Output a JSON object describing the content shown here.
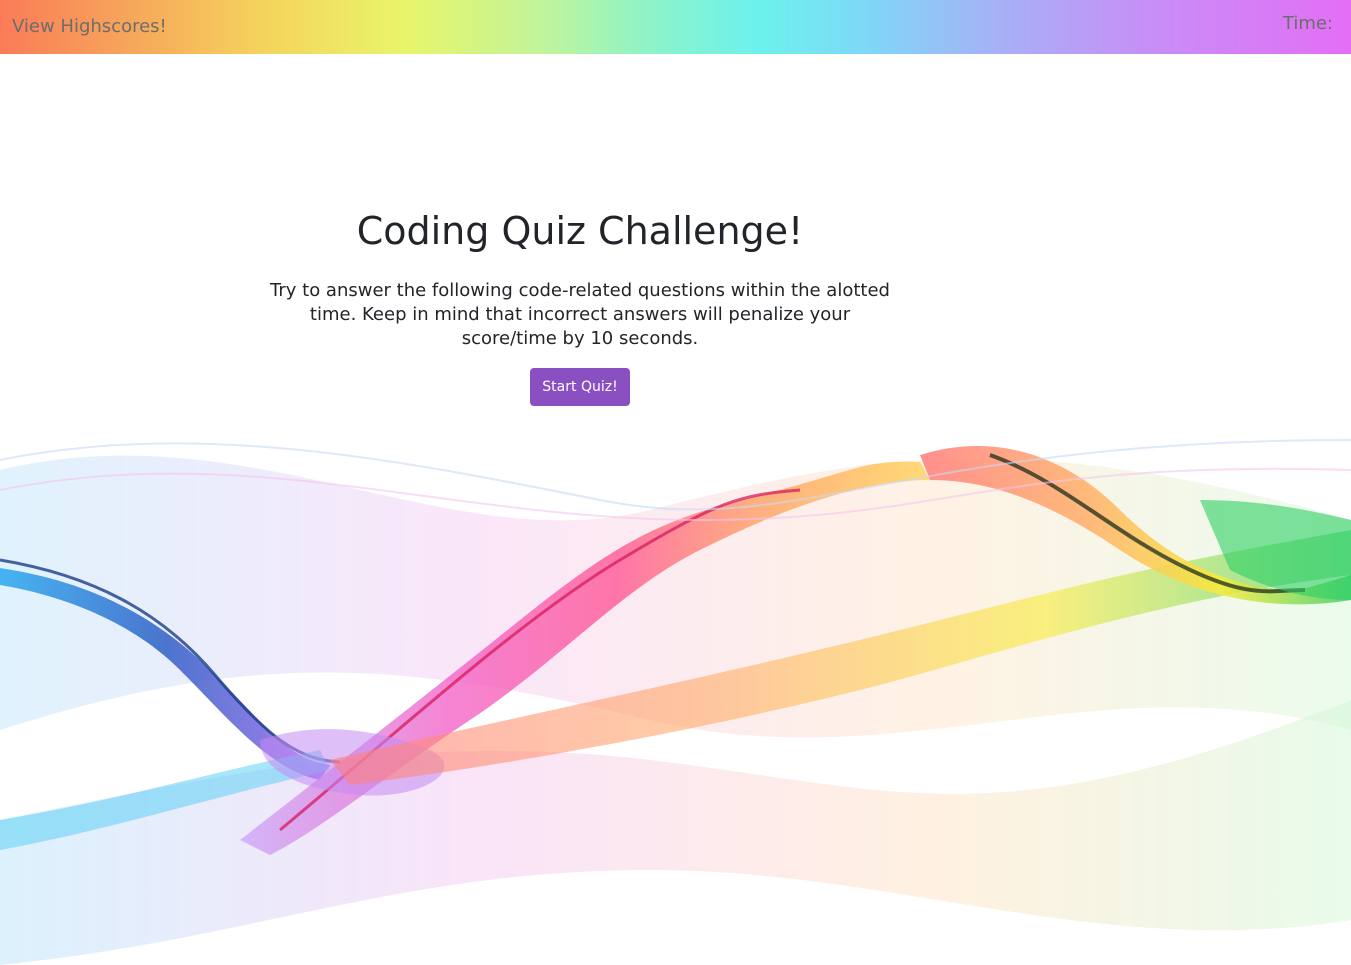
{
  "header": {
    "highscores_label": "View Highscores!",
    "timer_label": "Time:",
    "timer_value": ""
  },
  "main": {
    "title": "Coding Quiz Challenge!",
    "intro": "Try to answer the following code-related questions within the alotted time. Keep in mind that incorrect answers will penalize your score/time by 10 seconds.",
    "start_label": "Start Quiz!"
  },
  "colors": {
    "button": "#8a4fc1",
    "text": "#212529",
    "header_text": "#6d6d6d"
  }
}
